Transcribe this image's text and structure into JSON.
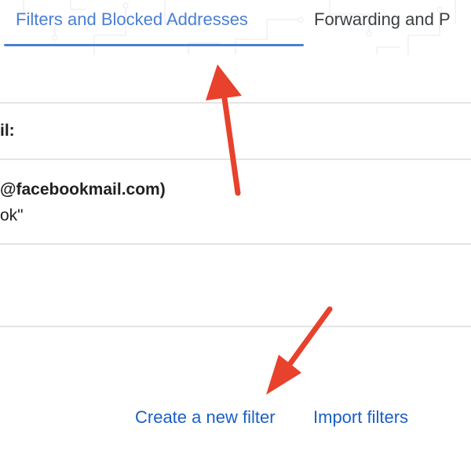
{
  "tabs": [
    {
      "label": "Filters and Blocked Addresses",
      "active": true
    },
    {
      "label": "Forwarding and P",
      "active": false
    }
  ],
  "filters_section": {
    "header_label": "il:",
    "filter_from": "@facebookmail.com)",
    "filter_subject": "ok\""
  },
  "actions": {
    "create_filter": "Create a new filter",
    "import_filters": "Import filters"
  },
  "colors": {
    "active_tab": "#4a7fd4",
    "link": "#1a5fc6",
    "annotation_arrow": "#e8412c",
    "divider": "#e4e4e4"
  }
}
